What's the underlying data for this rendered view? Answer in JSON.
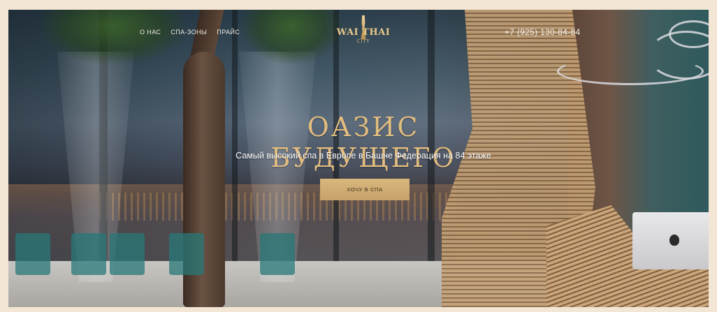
{
  "nav": {
    "items": [
      {
        "label": "О НАС"
      },
      {
        "label": "СПА-ЗОНЫ"
      },
      {
        "label": "ПРАЙС"
      }
    ]
  },
  "logo": {
    "text": "WAI THAI",
    "sub": "CITY"
  },
  "header": {
    "phone": "+7 (925) 130-84-84"
  },
  "hero": {
    "headline": "ОАЗИС БУДУЩЕГО",
    "subtitle": "Самый высокий спа в Европе в Башне Федерация на 84 этаже",
    "cta_label": "ХОЧУ В СПА"
  },
  "colors": {
    "accent": "#d9b77d",
    "headline": "#e2bd80",
    "page_background": "#f3e6d4"
  }
}
